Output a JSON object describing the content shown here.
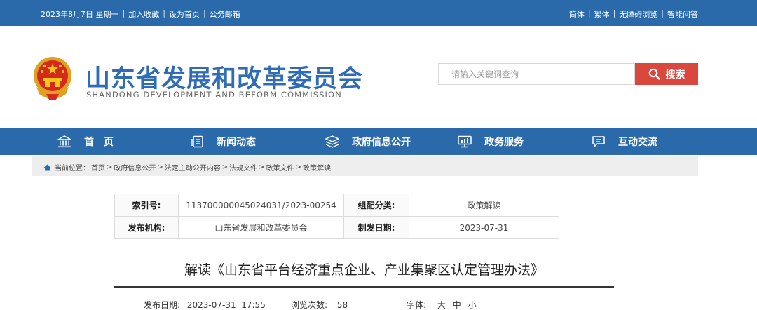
{
  "topbar": {
    "date": "2023年8月7日 星期一",
    "add_favorite": "加入收藏",
    "set_home": "设为首页",
    "public_mail": "公务邮箱",
    "simplified": "简体",
    "traditional": "繁体",
    "accessible": "无障碍浏览",
    "smart_qa": "智能问答",
    "separator": "|"
  },
  "header": {
    "title": "山东省发展和改革委员会",
    "subtitle": "SHANDONG DEVELOPMENT AND REFORM COMMISSION",
    "search_placeholder": "请输入关键词查询",
    "search_button": "搜索"
  },
  "nav": [
    {
      "label": "首　页",
      "icon": "home-icon"
    },
    {
      "label": "新闻动态",
      "icon": "news-icon"
    },
    {
      "label": "政府信息公开",
      "icon": "layers-icon"
    },
    {
      "label": "政务服务",
      "icon": "monitor-icon"
    },
    {
      "label": "互动交流",
      "icon": "chat-icon"
    }
  ],
  "breadcrumb": {
    "prefix": "当前位置：",
    "items": [
      "首页",
      "政府信息公开",
      "法定主动公开内容",
      "法规文件",
      "政策文件",
      "政策解读"
    ],
    "separator": ">"
  },
  "meta": {
    "index_label": "索引号:",
    "index_value": "113700000045024031/2023-00254",
    "category_label": "组配分类:",
    "category_value": "政策解读",
    "publisher_label": "发布机构:",
    "publisher_value": "山东省发展和改革委员会",
    "date_label": "制发日期:",
    "date_value": "2023-07-31"
  },
  "article": {
    "title": "解读《山东省平台经济重点企业、产业集聚区认定管理办法》",
    "publish_label": "发布日期:",
    "publish_value": "2023-07-31  17:55",
    "views_label": "浏览次数:",
    "views_value": "58",
    "font_label": "字体:",
    "font_large": "大",
    "font_medium": "中",
    "font_small": "小"
  },
  "colors": {
    "primary_blue": "#2a6aaa",
    "title_blue": "#2f6cb5",
    "search_red": "#d9473d"
  }
}
